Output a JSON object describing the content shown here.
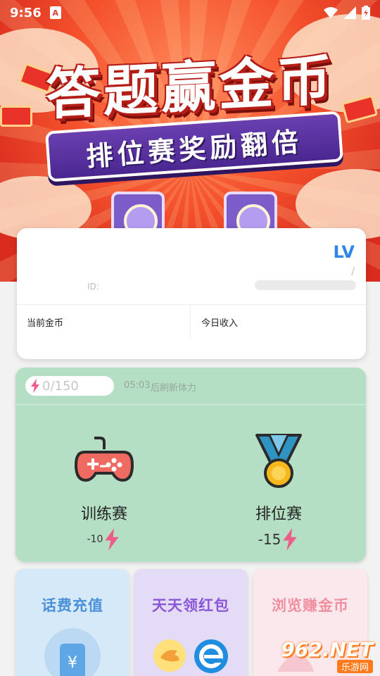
{
  "status_bar": {
    "time": "9:56",
    "app_icon": "A"
  },
  "banner": {
    "title": "答题赢金币",
    "subtitle": "排位赛奖励翻倍"
  },
  "user_card": {
    "level_label": "LV",
    "level_separator": "/",
    "id_label": "ID:",
    "stats": [
      {
        "label": "当前金币"
      },
      {
        "label": "今日收入"
      }
    ]
  },
  "energy": {
    "value": "0/150",
    "refresh_time": "05:03",
    "refresh_text": "后刷新体力"
  },
  "games": [
    {
      "name": "训练赛",
      "cost": "-10",
      "icon": "gamepad-icon"
    },
    {
      "name": "排位赛",
      "cost": "-15",
      "icon": "medal-icon"
    }
  ],
  "features": [
    {
      "title": "话费充值",
      "color": "#4a90d9",
      "bg": "#d6e9f8",
      "icon": "phone-recharge-icon"
    },
    {
      "title": "天天领红包",
      "color": "#8a56d8",
      "bg": "#e4dcf6",
      "icon": "red-packet-icon"
    },
    {
      "title": "浏览赚金币",
      "color": "#ef8fa0",
      "bg": "#fbe8ec",
      "icon": "browse-coin-icon"
    }
  ],
  "watermark": {
    "main": "962.NET",
    "sub": "乐游网"
  }
}
